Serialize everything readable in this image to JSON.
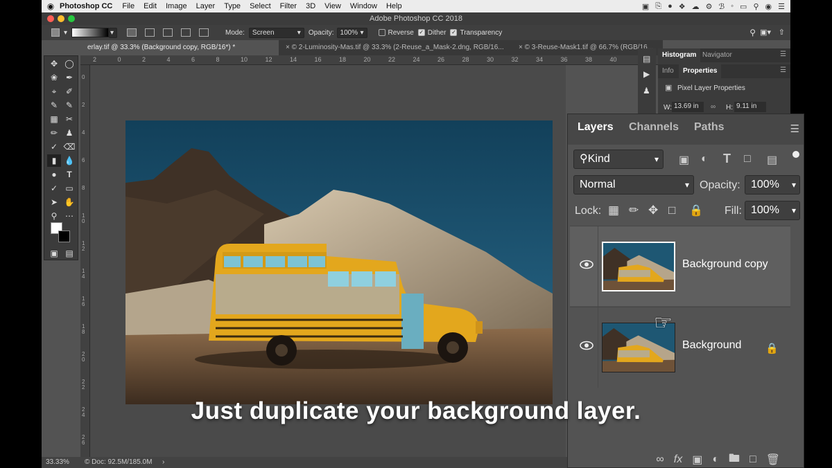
{
  "menubar": {
    "app_name": "Photoshop CC",
    "items": [
      "File",
      "Edit",
      "Image",
      "Layer",
      "Type",
      "Select",
      "Filter",
      "3D",
      "View",
      "Window",
      "Help"
    ]
  },
  "window": {
    "title": "Adobe Photoshop CC 2018"
  },
  "options_bar": {
    "mode_label": "Mode:",
    "mode_value": "Screen",
    "opacity_label": "Opacity:",
    "opacity_value": "100%",
    "reverse_label": "Reverse",
    "dither_label": "Dither",
    "transparency_label": "Transparency"
  },
  "tabs": [
    {
      "label": "erlay.tif @ 33.3% (Background copy, RGB/16*) *",
      "active": true
    },
    {
      "label": "2-Luminosity-Mas.tif @ 33.3% (2-Reuse_a_Mask-2.dng, RGB/16...",
      "active": false
    },
    {
      "label": "3-Reuse-Mask1.tif @ 66.7% (RGB/16...",
      "active": false
    }
  ],
  "ruler_top": [
    "2",
    "0",
    "2",
    "4",
    "6",
    "8",
    "10",
    "12",
    "14",
    "16",
    "18",
    "20",
    "22",
    "24",
    "26",
    "28",
    "30",
    "32",
    "34",
    "36",
    "38",
    "40"
  ],
  "ruler_left": [
    "0",
    "2",
    "4",
    "6",
    "8",
    "1\n0",
    "1\n2",
    "1\n4",
    "1\n6",
    "1\n8",
    "2\n0",
    "2\n2",
    "2\n4",
    "2\n6"
  ],
  "status": {
    "zoom": "33.33%",
    "doc": "Doc: 92.5M/185.0M"
  },
  "panels": {
    "histogram_tab": "Histogram",
    "navigator_tab": "Navigator",
    "info_tab": "Info",
    "properties_tab": "Properties",
    "properties_title": "Pixel Layer Properties",
    "w_label": "W:",
    "w_value": "13.69 in",
    "h_label": "H:",
    "h_value": "9.11 in"
  },
  "layers_panel": {
    "tab_layers": "Layers",
    "tab_channels": "Channels",
    "tab_paths": "Paths",
    "kind_label": "Kind",
    "blend_mode": "Normal",
    "opacity_label": "Opacity:",
    "opacity_value": "100%",
    "lock_label": "Lock:",
    "fill_label": "Fill:",
    "fill_value": "100%",
    "layers": [
      {
        "name": "Background copy",
        "selected": true,
        "locked": false
      },
      {
        "name": "Background",
        "selected": false,
        "locked": true
      }
    ]
  },
  "caption": "Just duplicate your background layer."
}
